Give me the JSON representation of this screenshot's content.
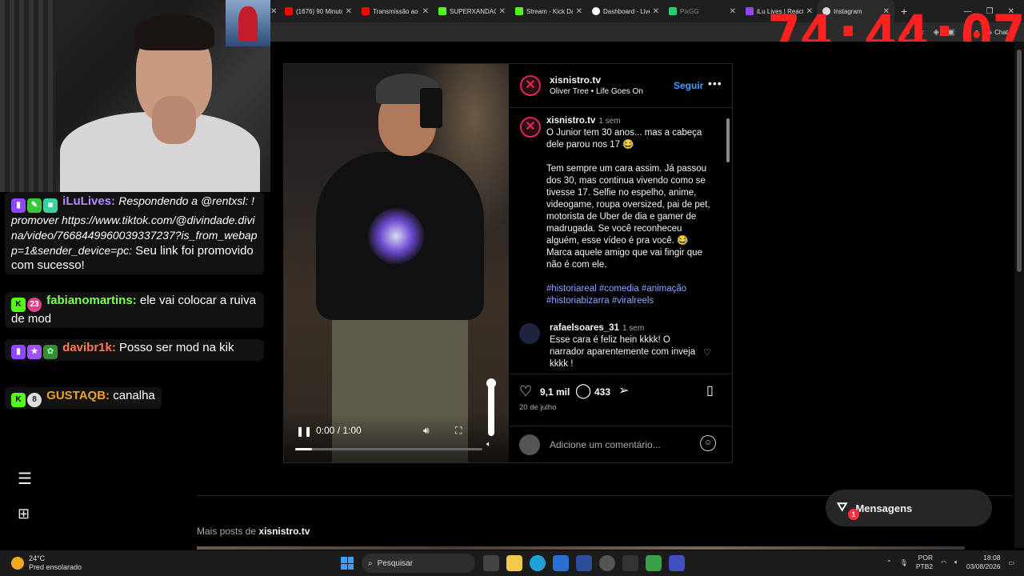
{
  "browser": {
    "tabs": [
      {
        "label": "(1676) 90 Minuto",
        "icon_color": "#ff0000"
      },
      {
        "label": "Transmissão ao vivo",
        "icon_color": "#ff0000"
      },
      {
        "label": "SUPERXANDAO",
        "icon_color": "#53fc18"
      },
      {
        "label": "Stream - Kick Das",
        "icon_color": "#53fc18"
      },
      {
        "label": "Dashboard - Live",
        "icon_color": "#ffffff"
      },
      {
        "label": "PixGG",
        "icon_color": "#2ecc71"
      },
      {
        "label": "iLu Lives | React",
        "icon_color": "#9146ff"
      },
      {
        "label": "Instagram",
        "icon_color": "#dddddd"
      }
    ],
    "chat_button": "Chat"
  },
  "timer": "74:44:07",
  "stream_chat": [
    {
      "user": "iLuLives:",
      "user_color": "#b18cff",
      "text": "Respondendo a @rentxsl: !promover https://www.tiktok.com/@divindade.divina/video/7668449960039337237?is_from_webapp=1&sender_device=pc:",
      "text2": "Seu link foi promovido com sucesso!"
    },
    {
      "user": "fabianomartins:",
      "user_color": "#7cff5a",
      "badge_num": "23",
      "text": "ele vai colocar a ruiva de mod"
    },
    {
      "user": "davibr1k:",
      "user_color": "#ff7a5a",
      "text": "Posso ser mod na kik"
    },
    {
      "user": "GUSTAQB:",
      "user_color": "#f0a020",
      "badge_num": "8",
      "text": "canalha"
    }
  ],
  "post": {
    "author": "xisnistro.tv",
    "music_artist": "Oliver Tree",
    "music_song": "Life Goes On",
    "follow": "Seguir",
    "caption_time": "1 sem",
    "caption_lines": [
      "O Junior tem 30 anos... mas a cabeça dele parou nos 17 😂",
      "Tem sempre um cara assim. Já passou dos 30, mas continua vivendo como se tivesse 17. Selfie no espelho, anime, videogame, roupa oversized, pai de pet, motorista de Uber de dia e gamer de madrugada. Se você reconheceu alguém, esse vídeo é pra você. 😂 Marca aquele amigo que vai fingir que não é com ele."
    ],
    "hashtags": "#historiareal #comedia #animação #historiabizarra #viralreels",
    "reply_user": "rafaelsoares_31",
    "reply_time": "1 sem",
    "reply_text": "Esse cara é feliz hein kkkk! O narrador aparentemente com inveja kkkk !",
    "likes": "9,1 mil",
    "comments": "433",
    "date": "20 de julho",
    "add_comment_placeholder": "Adicione um comentário...",
    "video_time": "0:00 / 1:00",
    "video_progress": 0.09,
    "more_posts_label": "Mais posts de",
    "more_posts_user": "xisnistro.tv"
  },
  "messages_button": {
    "label": "Mensagens",
    "badge": "1"
  },
  "taskbar": {
    "temp": "24°C",
    "weather": "Pred ensolarado",
    "search_placeholder": "Pesquisar",
    "lang1": "POR",
    "lang2": "PTB2",
    "time": "18:08",
    "date": "03/08/2026"
  }
}
